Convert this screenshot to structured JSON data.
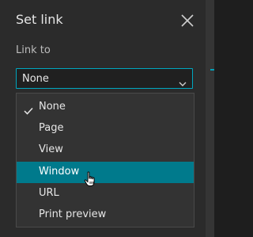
{
  "dialog": {
    "title": "Set link",
    "close_icon": "close-icon"
  },
  "link_to": {
    "label": "Link to",
    "selected": "None",
    "chevron_icon": "chevron-down-icon"
  },
  "options": [
    {
      "label": "None",
      "checked": true
    },
    {
      "label": "Page",
      "checked": false
    },
    {
      "label": "View",
      "checked": false
    },
    {
      "label": "Window",
      "checked": false,
      "hovered": true
    },
    {
      "label": "URL",
      "checked": false
    },
    {
      "label": "Print preview",
      "checked": false
    }
  ],
  "colors": {
    "accent": "#00a6bf",
    "hover": "#007a8c",
    "panel": "#2b2b2b"
  }
}
